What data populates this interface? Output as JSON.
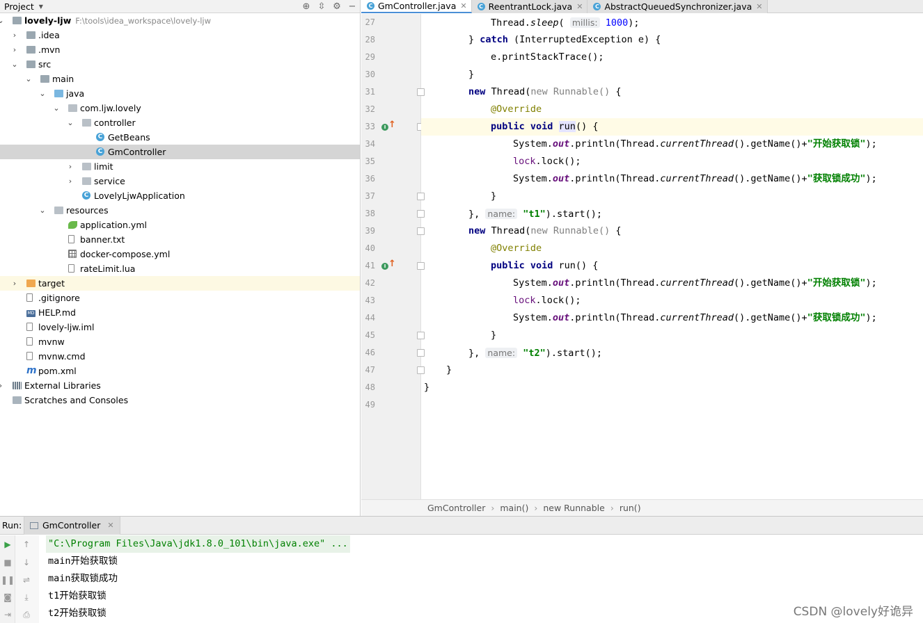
{
  "project_panel": {
    "title": "Project",
    "tree": [
      {
        "label": "lovely-ljw",
        "path": "F:\\tools\\idea_workspace\\lovely-ljw",
        "bold": true,
        "depth": 0,
        "arrow": "down",
        "icon": "module-folder-icon"
      },
      {
        "label": ".idea",
        "depth": 1,
        "arrow": "right",
        "icon": "folder-icon"
      },
      {
        "label": ".mvn",
        "depth": 1,
        "arrow": "right",
        "icon": "folder-icon"
      },
      {
        "label": "src",
        "depth": 1,
        "arrow": "down",
        "icon": "folder-icon"
      },
      {
        "label": "main",
        "depth": 2,
        "arrow": "down",
        "icon": "folder-icon"
      },
      {
        "label": "java",
        "depth": 3,
        "arrow": "down",
        "icon": "source-folder-icon"
      },
      {
        "label": "com.ljw.lovely",
        "depth": 4,
        "arrow": "down",
        "icon": "package-icon"
      },
      {
        "label": "controller",
        "depth": 5,
        "arrow": "down",
        "icon": "package-icon"
      },
      {
        "label": "GetBeans",
        "depth": 6,
        "arrow": "",
        "icon": "class-icon"
      },
      {
        "label": "GmController",
        "depth": 6,
        "arrow": "",
        "icon": "class-icon",
        "selected": true
      },
      {
        "label": "limit",
        "depth": 5,
        "arrow": "right",
        "icon": "package-icon"
      },
      {
        "label": "service",
        "depth": 5,
        "arrow": "right",
        "icon": "package-icon"
      },
      {
        "label": "LovelyLjwApplication",
        "depth": 5,
        "arrow": "",
        "icon": "spring-class-icon"
      },
      {
        "label": "resources",
        "depth": 3,
        "arrow": "down",
        "icon": "resources-folder-icon"
      },
      {
        "label": "application.yml",
        "depth": 4,
        "arrow": "",
        "icon": "spring-config-icon"
      },
      {
        "label": "banner.txt",
        "depth": 4,
        "arrow": "",
        "icon": "text-file-icon"
      },
      {
        "label": "docker-compose.yml",
        "depth": 4,
        "arrow": "",
        "icon": "yaml-file-icon"
      },
      {
        "label": "rateLimit.lua",
        "depth": 4,
        "arrow": "",
        "icon": "file-icon"
      },
      {
        "label": "target",
        "depth": 1,
        "arrow": "right",
        "icon": "excluded-folder-icon",
        "highlight": true
      },
      {
        "label": ".gitignore",
        "depth": 1,
        "arrow": "",
        "icon": "file-icon"
      },
      {
        "label": "HELP.md",
        "depth": 1,
        "arrow": "",
        "icon": "markdown-icon"
      },
      {
        "label": "lovely-ljw.iml",
        "depth": 1,
        "arrow": "",
        "icon": "file-icon"
      },
      {
        "label": "mvnw",
        "depth": 1,
        "arrow": "",
        "icon": "file-icon"
      },
      {
        "label": "mvnw.cmd",
        "depth": 1,
        "arrow": "",
        "icon": "file-icon"
      },
      {
        "label": "pom.xml",
        "depth": 1,
        "arrow": "",
        "icon": "maven-icon"
      },
      {
        "label": "External Libraries",
        "depth": 0,
        "arrow": "right",
        "icon": "libraries-icon"
      },
      {
        "label": "Scratches and Consoles",
        "depth": 0,
        "arrow": "",
        "icon": "scratches-icon"
      }
    ]
  },
  "tabs": [
    {
      "label": "GmController.java",
      "active": true
    },
    {
      "label": "ReentrantLock.java",
      "active": false
    },
    {
      "label": "AbstractQueuedSynchronizer.java",
      "active": false
    }
  ],
  "editor": {
    "lines": [
      {
        "n": "27",
        "indent": 6,
        "tokens": [
          [
            "",
            "Thread."
          ],
          [
            "it",
            "sleep"
          ],
          [
            "",
            "( "
          ],
          [
            "hint",
            "millis:"
          ],
          [
            "num",
            " 1000"
          ],
          [
            "",
            ");"
          ]
        ]
      },
      {
        "n": "28",
        "indent": 4,
        "tokens": [
          [
            "",
            "} "
          ],
          [
            "kw",
            "catch"
          ],
          [
            "",
            " (InterruptedException e) {"
          ]
        ]
      },
      {
        "n": "29",
        "indent": 6,
        "tokens": [
          [
            "",
            "e.printStackTrace();"
          ]
        ]
      },
      {
        "n": "30",
        "indent": 4,
        "tokens": [
          [
            "",
            "}"
          ]
        ]
      },
      {
        "n": "31",
        "indent": 4,
        "fold": true,
        "tokens": [
          [
            "kw",
            "new"
          ],
          [
            "",
            " Thread("
          ],
          [
            "gray",
            "new Runnable()"
          ],
          [
            "",
            " {"
          ]
        ]
      },
      {
        "n": "32",
        "indent": 6,
        "tokens": [
          [
            "ann",
            "@Override"
          ]
        ]
      },
      {
        "n": "33",
        "indent": 6,
        "fold": true,
        "marker": true,
        "current": true,
        "tokens": [
          [
            "kw",
            "public void"
          ],
          [
            "",
            " "
          ],
          [
            "runhl",
            "run"
          ],
          [
            "",
            "() {"
          ]
        ]
      },
      {
        "n": "34",
        "indent": 8,
        "tokens": [
          [
            "",
            "System."
          ],
          [
            "fld",
            "out"
          ],
          [
            "",
            ".println(Thread."
          ],
          [
            "it",
            "currentThread"
          ],
          [
            "",
            "().getName()+"
          ],
          [
            "str",
            "\"开始获取锁\""
          ],
          [
            "",
            ");"
          ]
        ]
      },
      {
        "n": "35",
        "indent": 8,
        "tokens": [
          [
            "lv",
            "lock"
          ],
          [
            "",
            ".lock();"
          ]
        ]
      },
      {
        "n": "36",
        "indent": 8,
        "tokens": [
          [
            "",
            "System."
          ],
          [
            "fld",
            "out"
          ],
          [
            "",
            ".println(Thread."
          ],
          [
            "it",
            "currentThread"
          ],
          [
            "",
            "().getName()+"
          ],
          [
            "str",
            "\"获取锁成功\""
          ],
          [
            "",
            ");"
          ]
        ]
      },
      {
        "n": "37",
        "indent": 6,
        "fold": true,
        "tokens": [
          [
            "",
            "}"
          ]
        ]
      },
      {
        "n": "38",
        "indent": 4,
        "fold": true,
        "tokens": [
          [
            "",
            "}, "
          ],
          [
            "hint",
            "name:"
          ],
          [
            "",
            " "
          ],
          [
            "str",
            "\"t1\""
          ],
          [
            "",
            ").start();"
          ]
        ]
      },
      {
        "n": "39",
        "indent": 4,
        "fold": true,
        "tokens": [
          [
            "kw",
            "new"
          ],
          [
            "",
            " Thread("
          ],
          [
            "gray",
            "new Runnable()"
          ],
          [
            "",
            " {"
          ]
        ]
      },
      {
        "n": "40",
        "indent": 6,
        "tokens": [
          [
            "ann",
            "@Override"
          ]
        ]
      },
      {
        "n": "41",
        "indent": 6,
        "fold": true,
        "marker": true,
        "tokens": [
          [
            "kw",
            "public void"
          ],
          [
            "",
            " run() {"
          ]
        ]
      },
      {
        "n": "42",
        "indent": 8,
        "tokens": [
          [
            "",
            "System."
          ],
          [
            "fld",
            "out"
          ],
          [
            "",
            ".println(Thread."
          ],
          [
            "it",
            "currentThread"
          ],
          [
            "",
            "().getName()+"
          ],
          [
            "str",
            "\"开始获取锁\""
          ],
          [
            "",
            ");"
          ]
        ]
      },
      {
        "n": "43",
        "indent": 8,
        "tokens": [
          [
            "lv",
            "lock"
          ],
          [
            "",
            ".lock();"
          ]
        ]
      },
      {
        "n": "44",
        "indent": 8,
        "tokens": [
          [
            "",
            "System."
          ],
          [
            "fld",
            "out"
          ],
          [
            "",
            ".println(Thread."
          ],
          [
            "it",
            "currentThread"
          ],
          [
            "",
            "().getName()+"
          ],
          [
            "str",
            "\"获取锁成功\""
          ],
          [
            "",
            ");"
          ]
        ]
      },
      {
        "n": "45",
        "indent": 6,
        "fold": true,
        "tokens": [
          [
            "",
            "}"
          ]
        ]
      },
      {
        "n": "46",
        "indent": 4,
        "fold": true,
        "tokens": [
          [
            "",
            "}, "
          ],
          [
            "hint",
            "name:"
          ],
          [
            "",
            " "
          ],
          [
            "str",
            "\"t2\""
          ],
          [
            "",
            ").start();"
          ]
        ]
      },
      {
        "n": "47",
        "indent": 2,
        "fold": true,
        "tokens": [
          [
            "",
            "}"
          ]
        ]
      },
      {
        "n": "48",
        "indent": 0,
        "tokens": [
          [
            "",
            "}"
          ]
        ]
      },
      {
        "n": "49",
        "indent": 0,
        "tokens": []
      }
    ]
  },
  "breadcrumb": [
    "GmController",
    "main()",
    "new Runnable",
    "run()"
  ],
  "run_panel": {
    "label": "Run:",
    "tab": "GmController",
    "console": [
      {
        "text": "\"C:\\Program Files\\Java\\jdk1.8.0_101\\bin\\java.exe\" ...",
        "cmd": true
      },
      {
        "text": "main开始获取锁"
      },
      {
        "text": "main获取锁成功"
      },
      {
        "text": "t1开始获取锁"
      },
      {
        "text": "t2开始获取锁"
      }
    ]
  },
  "watermark": "CSDN @lovely好诡异",
  "colors": {
    "keyword": "#000080",
    "string": "#008000",
    "annotation": "#808000",
    "field": "#660e7a",
    "number": "#0000ff",
    "selection": "#d5d5d5"
  }
}
